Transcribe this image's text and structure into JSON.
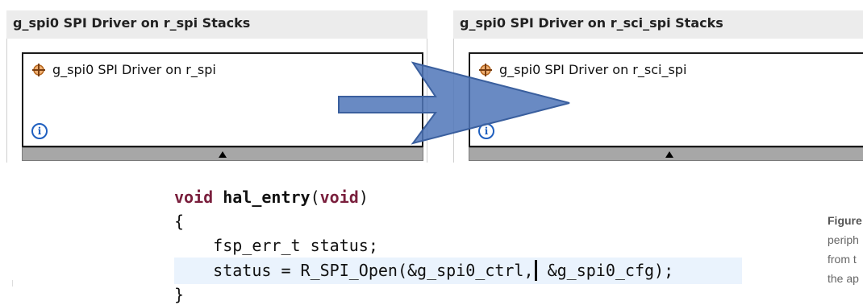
{
  "left_panel": {
    "title": "g_spi0 SPI Driver on r_spi Stacks",
    "module_label": "g_spi0 SPI Driver on r_spi",
    "info_icon": "i"
  },
  "right_panel": {
    "title": "g_spi0 SPI Driver on r_sci_spi Stacks",
    "module_label": "g_spi0 SPI Driver on r_sci_spi",
    "info_icon": "i"
  },
  "icons": {
    "module": "crosshair-component-icon",
    "info": "info-circle-icon",
    "collapse": "triangle-up-icon",
    "arrow": "right-arrow-icon"
  },
  "colors": {
    "arrow_fill": "#4f76b8",
    "keyword": "#7a1f3d",
    "highlight": "#eaf3fd",
    "info": "#1f5fbf"
  },
  "code": {
    "kw_void1": "void",
    "fn_name": "hal_entry",
    "paren_open": "(",
    "kw_void2": "void",
    "paren_close": ")",
    "line2": "{",
    "line3": "    fsp_err_t status;",
    "line4_a": "    status = R_SPI_Open(&g_spi0_ctrl,",
    "line4_b": " &g_spi0_cfg);",
    "line5": "}"
  },
  "caption": {
    "line1": "Figure",
    "line2": "periph",
    "line3": "from t",
    "line4": "the ap"
  }
}
